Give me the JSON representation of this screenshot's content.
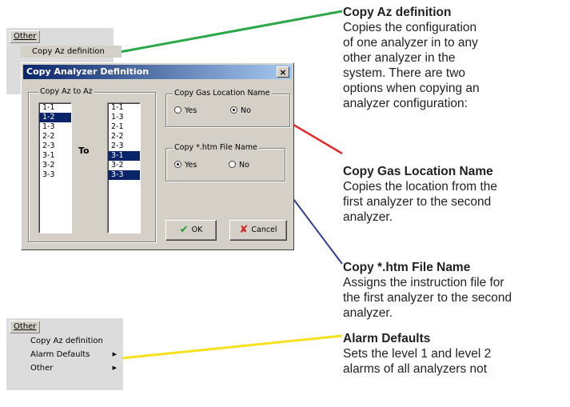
{
  "top_menu": {
    "menu_label": "Other",
    "item": "Copy Az definition"
  },
  "dialog": {
    "title": "Copy Analyzer Definition",
    "close_glyph": "×",
    "copy_group_title": "Copy Az to Az",
    "from_list": [
      "1-1",
      "1-2",
      "1-3",
      "2-2",
      "2-3",
      "3-1",
      "3-2",
      "3-3"
    ],
    "from_selected": "1-2",
    "to_label": "To",
    "to_list": [
      "1-1",
      "1-3",
      "2-1",
      "2-2",
      "2-3",
      "3-1",
      "3-2",
      "3-3"
    ],
    "to_selected": [
      "3-1",
      "3-3"
    ],
    "gas_group_title": "Copy Gas Location Name",
    "gas_yes": "Yes",
    "gas_no": "No",
    "gas_value": "No",
    "htm_group_title": "Copy *.htm File Name",
    "htm_yes": "Yes",
    "htm_no": "No",
    "htm_value": "Yes",
    "ok_label": "OK",
    "cancel_label": "Cancel"
  },
  "bottom_menu": {
    "menu_label": "Other",
    "items": [
      "Copy Az definition",
      "Alarm Defaults",
      "Other"
    ]
  },
  "annotations": [
    {
      "heading": "Copy Az definition",
      "body": [
        "Copies the configuration",
        "of one analyzer in to any",
        "other analyzer in the",
        "system. There are two",
        "options when copying an",
        "analyzer configuration:"
      ]
    },
    {
      "heading": "Copy Gas Location Name",
      "body": [
        "Copies the location from the",
        "first analyzer to the second",
        "analyzer."
      ]
    },
    {
      "heading": "Copy *.htm File Name",
      "body": [
        "Assigns the instruction file for",
        "the first analyzer to the second",
        "analyzer."
      ]
    },
    {
      "heading": "Alarm Defaults",
      "body": [
        "Sets the level 1 and level 2",
        "alarms of all analyzers not"
      ]
    }
  ],
  "colors": {
    "green_line": "#2ca84a",
    "red_line": "#e8262b",
    "blue_line": "#2c3d9b",
    "yellow_line": "#f6e11c",
    "title_start": "#0a246a",
    "selection": "#0a246a"
  }
}
